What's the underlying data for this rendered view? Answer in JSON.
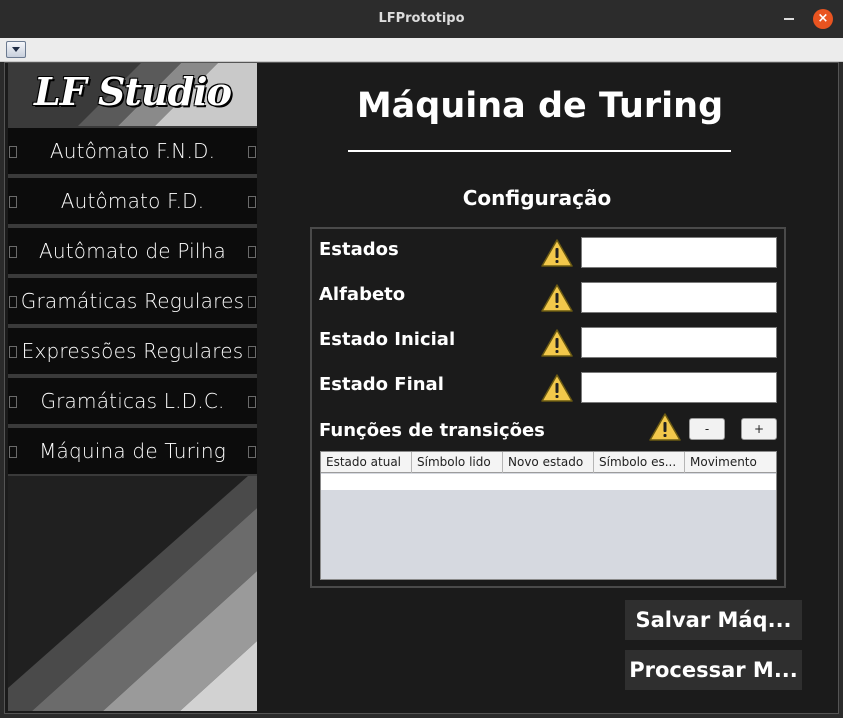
{
  "window": {
    "title": "LFPrototipo",
    "close_glyph": "×"
  },
  "sidebar": {
    "logo_text": "LF Studio",
    "items": [
      {
        "label": "Autômato F.N.D."
      },
      {
        "label": "Autômato F.D."
      },
      {
        "label": "Autômato de Pilha"
      },
      {
        "label": "Gramáticas Regulares"
      },
      {
        "label": "Expressões Regulares"
      },
      {
        "label": "Gramáticas L.D.C."
      },
      {
        "label": "Máquina de Turing"
      }
    ]
  },
  "main": {
    "title": "Máquina de Turing",
    "section_title": "Configuração",
    "fields": [
      {
        "label": "Estados",
        "value": ""
      },
      {
        "label": "Alfabeto",
        "value": ""
      },
      {
        "label": "Estado Inicial",
        "value": ""
      },
      {
        "label": "Estado Final",
        "value": ""
      }
    ],
    "transitions": {
      "label": "Funções de transições",
      "remove_label": "-",
      "add_label": "+",
      "columns": [
        "Estado atual",
        "Símbolo lido",
        "Novo estado",
        "Símbolo es...",
        "Movimento"
      ]
    },
    "buttons": {
      "save": "Salvar Máq...",
      "process": "Processar M..."
    }
  },
  "colors": {
    "warning": "#f2c84b",
    "accent_close": "#e95420",
    "background": "#1b1b1b"
  }
}
